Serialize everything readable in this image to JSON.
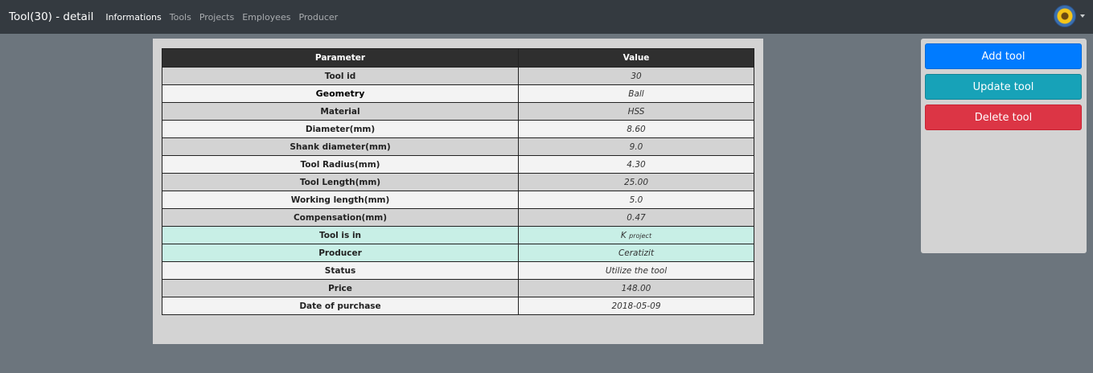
{
  "navbar": {
    "brand": "Tool(30) - detail",
    "links": [
      {
        "label": "Informations",
        "active": true
      },
      {
        "label": "Tools"
      },
      {
        "label": "Projects"
      },
      {
        "label": "Employees"
      },
      {
        "label": "Producer"
      }
    ]
  },
  "table": {
    "headers": [
      "Parameter",
      "Value"
    ],
    "rows": [
      {
        "param": "Tool id",
        "value": "30",
        "style": "gray"
      },
      {
        "param": "Geometry",
        "value": "Ball",
        "style": "light"
      },
      {
        "param": "Material",
        "value": "HSS",
        "style": "gray"
      },
      {
        "param": "Diameter(mm)",
        "value": "8.60",
        "style": "light"
      },
      {
        "param": "Shank diameter(mm)",
        "value": "9.0",
        "style": "gray"
      },
      {
        "param": "Tool Radius(mm)",
        "value": "4.30",
        "style": "light"
      },
      {
        "param": "Tool Length(mm)",
        "value": "25.00",
        "style": "gray"
      },
      {
        "param": "Working length(mm)",
        "value": "5.0",
        "style": "light"
      },
      {
        "param": "Compensation(mm)",
        "value": "0.47",
        "style": "gray"
      },
      {
        "param": "Tool is in",
        "value_main": "K",
        "value_small": "project",
        "style": "teal"
      },
      {
        "param": "Producer",
        "value": "Ceratizit",
        "style": "teal"
      },
      {
        "param": "Status",
        "value": "Utilize the tool",
        "style": "light"
      },
      {
        "param": "Price",
        "value": "148.00",
        "style": "gray"
      },
      {
        "param": "Date of purchase",
        "value": "2018-05-09",
        "style": "light"
      }
    ]
  },
  "actions": {
    "add": "Add tool",
    "update": "Update tool",
    "delete": "Delete tool"
  },
  "colors": {
    "navbar": "#343a40",
    "background": "#6c757d",
    "add": "#007bff",
    "update": "#17a2b8",
    "delete": "#dc3545",
    "highlight_row": "#c8efe6"
  },
  "icons": {
    "avatar": "sunflower-avatar-icon",
    "dropdown": "caret-down-icon"
  }
}
